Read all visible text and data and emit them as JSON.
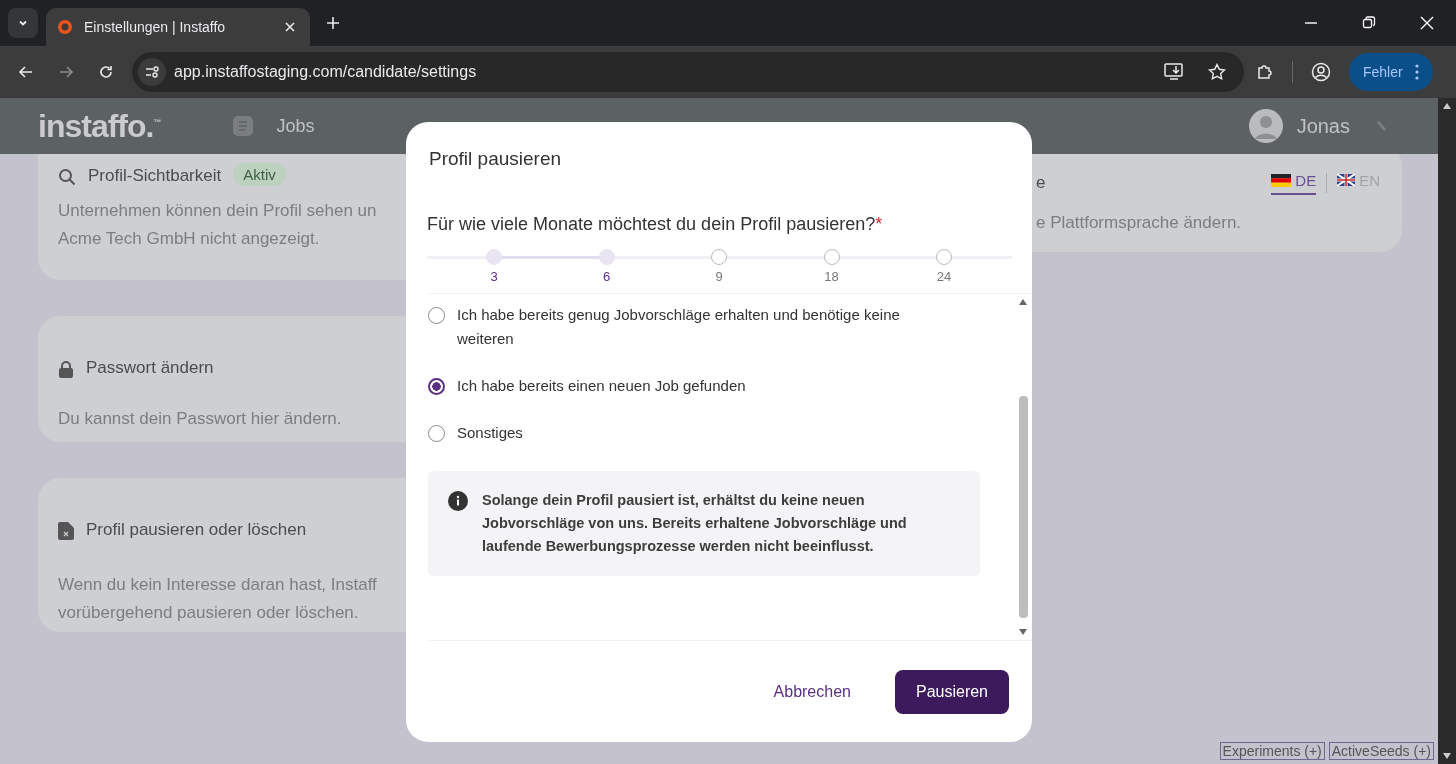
{
  "browser": {
    "tab": {
      "title": "Einstellungen | Instaffo"
    },
    "url": "app.instaffostaging.com/candidate/settings",
    "profile_button": "Fehler"
  },
  "header": {
    "logo": "instaffo.",
    "logo_mark": "™",
    "nav": [
      {
        "label": "Jobs"
      }
    ],
    "user": "Jonas"
  },
  "cards": [
    {
      "title": "Profil-Sichtbarkeit",
      "badge": "Aktiv",
      "lines": [
        "Unternehmen können dein Profil sehen un",
        "Acme Tech GmbH nicht angezeigt."
      ]
    },
    {
      "title": "Passwort ändern",
      "lines": [
        "Du kannst dein Passwort hier ändern."
      ]
    },
    {
      "title": "Profil pausieren oder löschen",
      "lines": [
        "Wenn du kein Interesse daran hast, Instaff",
        "vorübergehend pausieren oder löschen."
      ]
    }
  ],
  "language_card": {
    "title": "e",
    "languages": [
      {
        "code": "DE",
        "selected": true
      },
      {
        "code": "EN",
        "selected": false
      }
    ],
    "lines": [
      "e Plattformsprache ändern."
    ]
  },
  "modal": {
    "title": "Profil pausieren",
    "question": "Für wie viele Monate möchtest du dein Profil pausieren?",
    "required_mark": "*",
    "slider": {
      "level": 0.25,
      "stops": [
        "3",
        "6",
        "9",
        "18",
        "24"
      ]
    },
    "options": [
      {
        "label": "Ich habe bereits genug Jobvorschläge erhalten und benötige keine weiteren",
        "selected": false
      },
      {
        "label": "Ich habe bereits einen neuen Job gefunden",
        "selected": true
      },
      {
        "label": "Sonstiges",
        "selected": false
      }
    ],
    "info": "Solange dein Profil pausiert ist, erhältst du keine neuen Jobvorschläge von uns. Bereits erhaltene Jobvorschläge und laufende Bewerbungsprozesse werden nicht beeinflusst.",
    "cancel": "Abbrechen",
    "confirm": "Pausieren"
  },
  "debug_buttons": [
    "Experiments (+)",
    "ActiveSeeds (+)"
  ]
}
